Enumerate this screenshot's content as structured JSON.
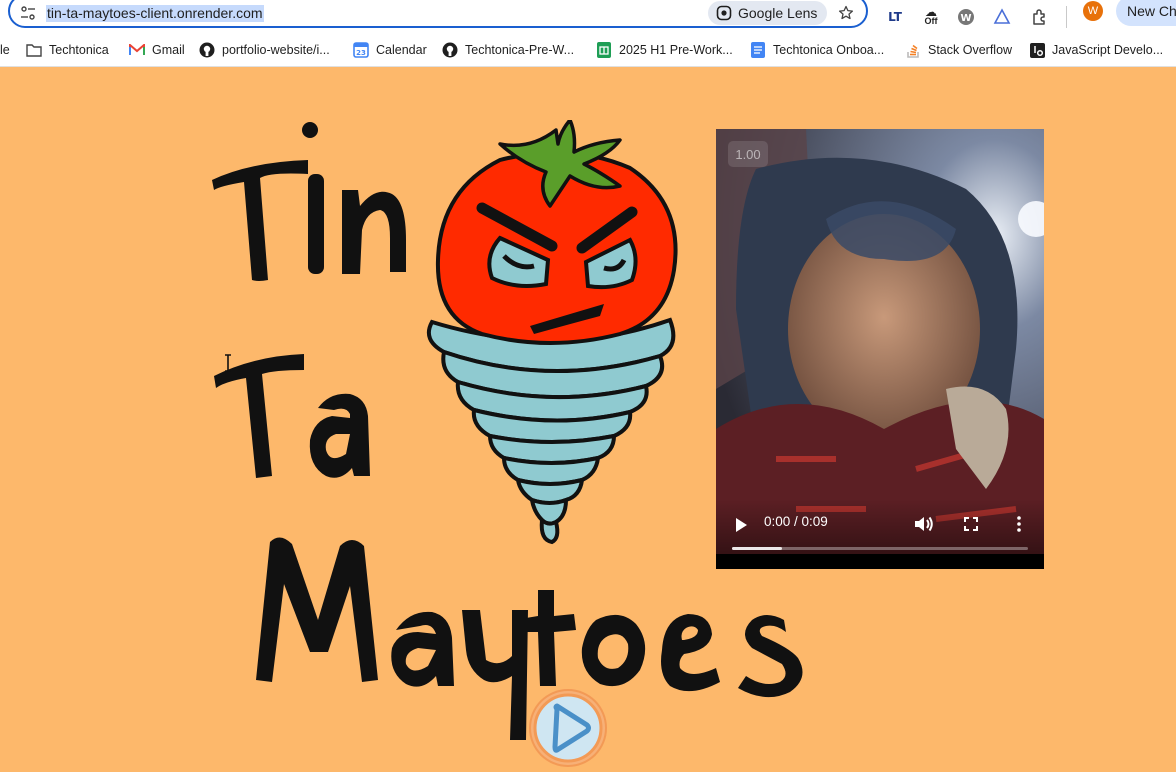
{
  "browser": {
    "url": "tin-ta-maytoes-client.onrender.com",
    "lens_label": "Google Lens",
    "ext_lt": "LT",
    "ext_off": "Off",
    "avatar_initial": "W",
    "new_chrome_label": "New Ch",
    "bookmarks": [
      {
        "label": "le",
        "icon": "partial-icon"
      },
      {
        "label": "Techtonica",
        "icon": "folder-icon"
      },
      {
        "label": "Gmail",
        "icon": "gmail-icon"
      },
      {
        "label": "portfolio-website/i...",
        "icon": "github-icon"
      },
      {
        "label": "Calendar",
        "icon": "calendar-icon"
      },
      {
        "label": "Techtonica-Pre-W...",
        "icon": "github-icon"
      },
      {
        "label": "2025 H1 Pre-Work...",
        "icon": "sheets-icon"
      },
      {
        "label": "Techtonica Onboa...",
        "icon": "docs-icon"
      },
      {
        "label": "Stack Overflow",
        "icon": "stackoverflow-icon"
      },
      {
        "label": "JavaScript Develo...",
        "icon": "js-icon"
      }
    ]
  },
  "logo": {
    "line1": "Tin",
    "line2": "Ta",
    "line3": "Maytoes"
  },
  "video": {
    "speed": "1.00",
    "time": "0:00 / 0:09",
    "progress_fraction": 0.17
  },
  "colors": {
    "page_bg": "#fdb86b",
    "tomato": "#ff2a00",
    "tornado": "#8fcad0",
    "leaf": "#5a9e2a"
  }
}
